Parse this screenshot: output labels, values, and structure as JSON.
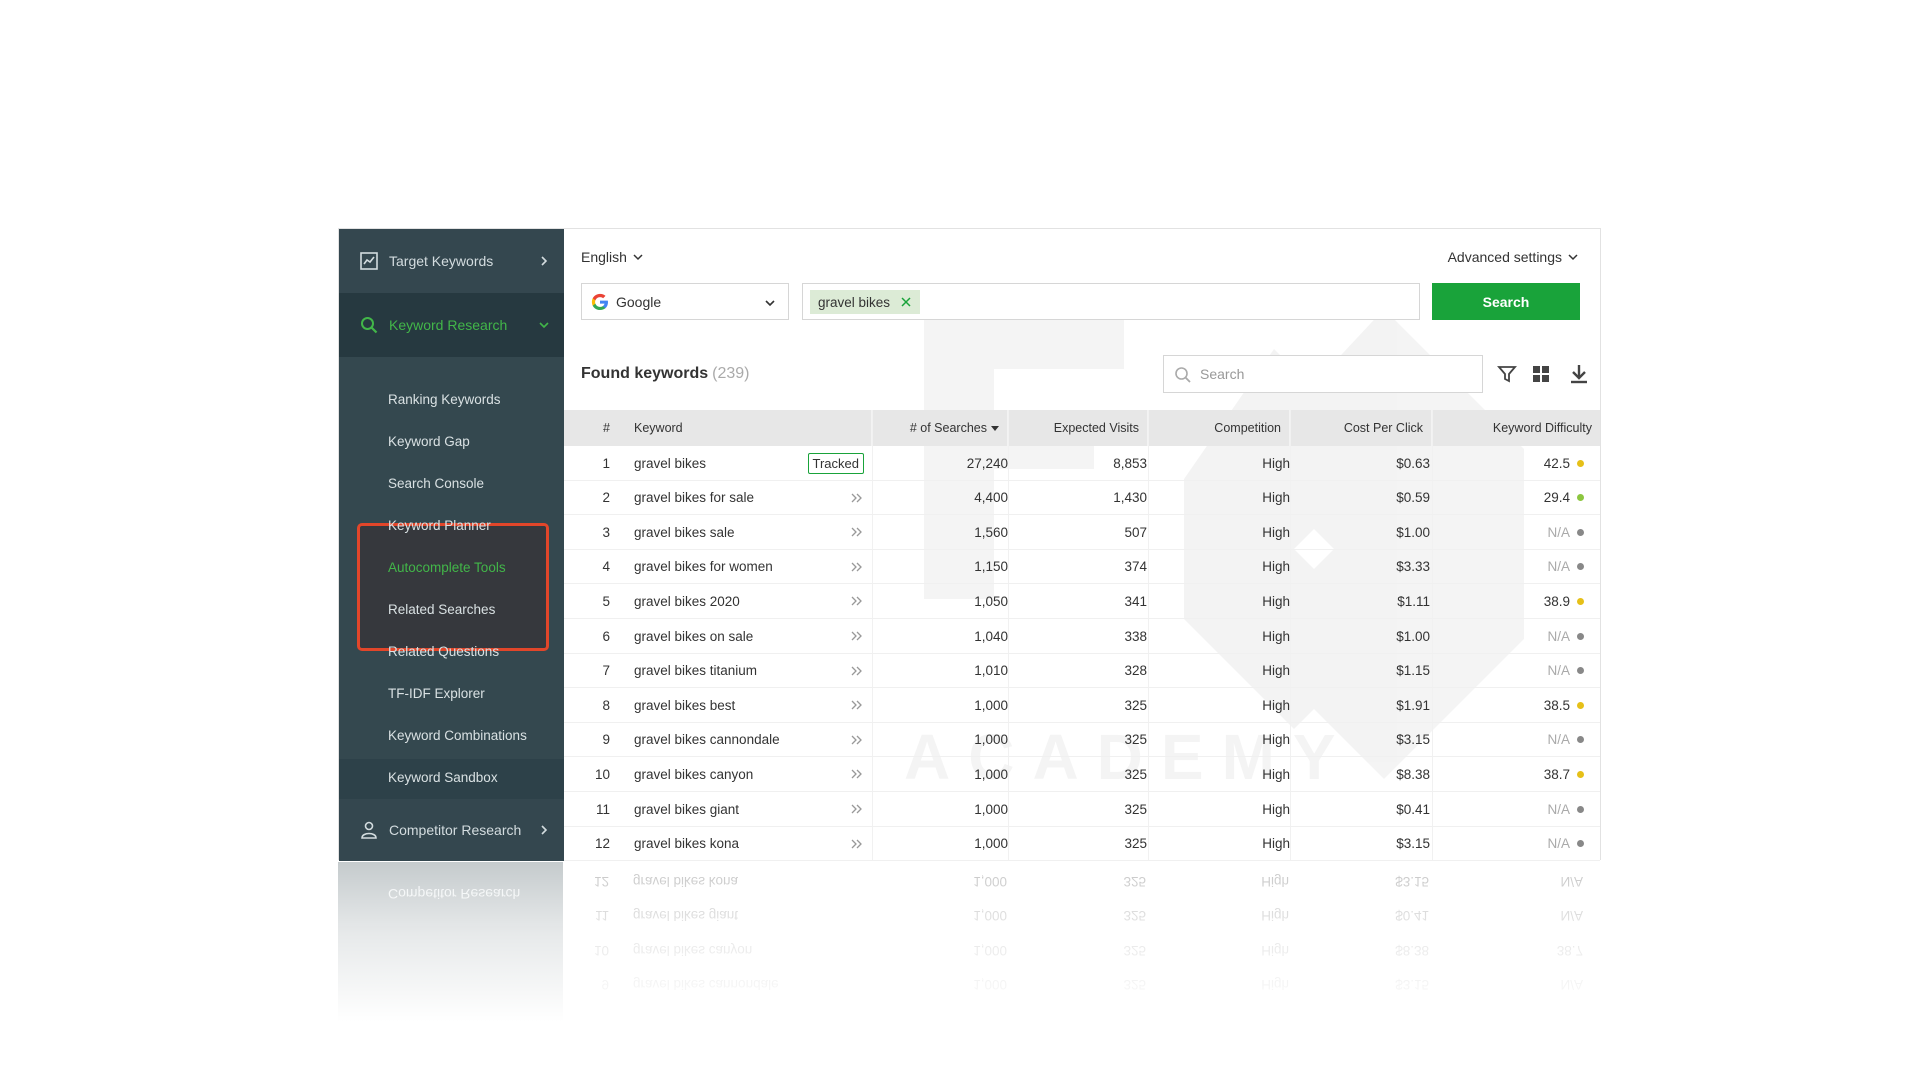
{
  "sidebar": {
    "sections": {
      "target": "Target Keywords",
      "research": "Keyword Research",
      "competitor": "Competitor Research"
    },
    "sub_items": [
      "Ranking Keywords",
      "Keyword Gap",
      "Search Console",
      "Keyword Planner",
      "Autocomplete Tools",
      "Related Searches",
      "Related Questions",
      "TF-IDF Explorer",
      "Keyword Combinations",
      "Keyword Sandbox"
    ],
    "active_sub_item": "Autocomplete Tools"
  },
  "toolbar": {
    "language": "English",
    "advanced_settings": "Advanced settings",
    "engine": "Google",
    "keyword_tag": "gravel bikes",
    "search_button": "Search"
  },
  "results": {
    "title": "Found keywords",
    "count": "(239)",
    "filter_placeholder": "Search"
  },
  "table": {
    "headers": [
      "#",
      "Keyword",
      "# of Searches",
      "Expected Visits",
      "Competition",
      "Cost Per Click",
      "Keyword Difficulty"
    ],
    "tracked_label": "Tracked",
    "rows": [
      {
        "n": "1",
        "kw": "gravel bikes",
        "tracked": true,
        "searches": "27,240",
        "visits": "8,853",
        "comp": "High",
        "cpc": "$0.63",
        "kd": "42.5",
        "dot": "yellow"
      },
      {
        "n": "2",
        "kw": "gravel bikes for sale",
        "tracked": false,
        "searches": "4,400",
        "visits": "1,430",
        "comp": "High",
        "cpc": "$0.59",
        "kd": "29.4",
        "dot": "green"
      },
      {
        "n": "3",
        "kw": "gravel bikes sale",
        "tracked": false,
        "searches": "1,560",
        "visits": "507",
        "comp": "High",
        "cpc": "$1.00",
        "kd": "N/A",
        "dot": "gray"
      },
      {
        "n": "4",
        "kw": "gravel bikes for women",
        "tracked": false,
        "searches": "1,150",
        "visits": "374",
        "comp": "High",
        "cpc": "$3.33",
        "kd": "N/A",
        "dot": "gray"
      },
      {
        "n": "5",
        "kw": "gravel bikes 2020",
        "tracked": false,
        "searches": "1,050",
        "visits": "341",
        "comp": "High",
        "cpc": "$1.11",
        "kd": "38.9",
        "dot": "yellow"
      },
      {
        "n": "6",
        "kw": "gravel bikes on sale",
        "tracked": false,
        "searches": "1,040",
        "visits": "338",
        "comp": "High",
        "cpc": "$1.00",
        "kd": "N/A",
        "dot": "gray"
      },
      {
        "n": "7",
        "kw": "gravel bikes titanium",
        "tracked": false,
        "searches": "1,010",
        "visits": "328",
        "comp": "High",
        "cpc": "$1.15",
        "kd": "N/A",
        "dot": "gray"
      },
      {
        "n": "8",
        "kw": "gravel bikes best",
        "tracked": false,
        "searches": "1,000",
        "visits": "325",
        "comp": "High",
        "cpc": "$1.91",
        "kd": "38.5",
        "dot": "yellow"
      },
      {
        "n": "9",
        "kw": "gravel bikes cannondale",
        "tracked": false,
        "searches": "1,000",
        "visits": "325",
        "comp": "High",
        "cpc": "$3.15",
        "kd": "N/A",
        "dot": "gray"
      },
      {
        "n": "10",
        "kw": "gravel bikes canyon",
        "tracked": false,
        "searches": "1,000",
        "visits": "325",
        "comp": "High",
        "cpc": "$8.38",
        "kd": "38.7",
        "dot": "yellow"
      },
      {
        "n": "11",
        "kw": "gravel bikes giant",
        "tracked": false,
        "searches": "1,000",
        "visits": "325",
        "comp": "High",
        "cpc": "$0.41",
        "kd": "N/A",
        "dot": "gray"
      },
      {
        "n": "12",
        "kw": "gravel bikes kona",
        "tracked": false,
        "searches": "1,000",
        "visits": "325",
        "comp": "High",
        "cpc": "$3.15",
        "kd": "N/A",
        "dot": "gray"
      }
    ]
  },
  "colors": {
    "accent_green": "#19a33a",
    "sidebar_bg": "#2d4149",
    "highlight_red": "#e2462a",
    "dot_yellow": "#e6c018",
    "dot_green": "#8cc63f",
    "dot_gray": "#888888"
  },
  "watermark_text": "ACADEMY"
}
